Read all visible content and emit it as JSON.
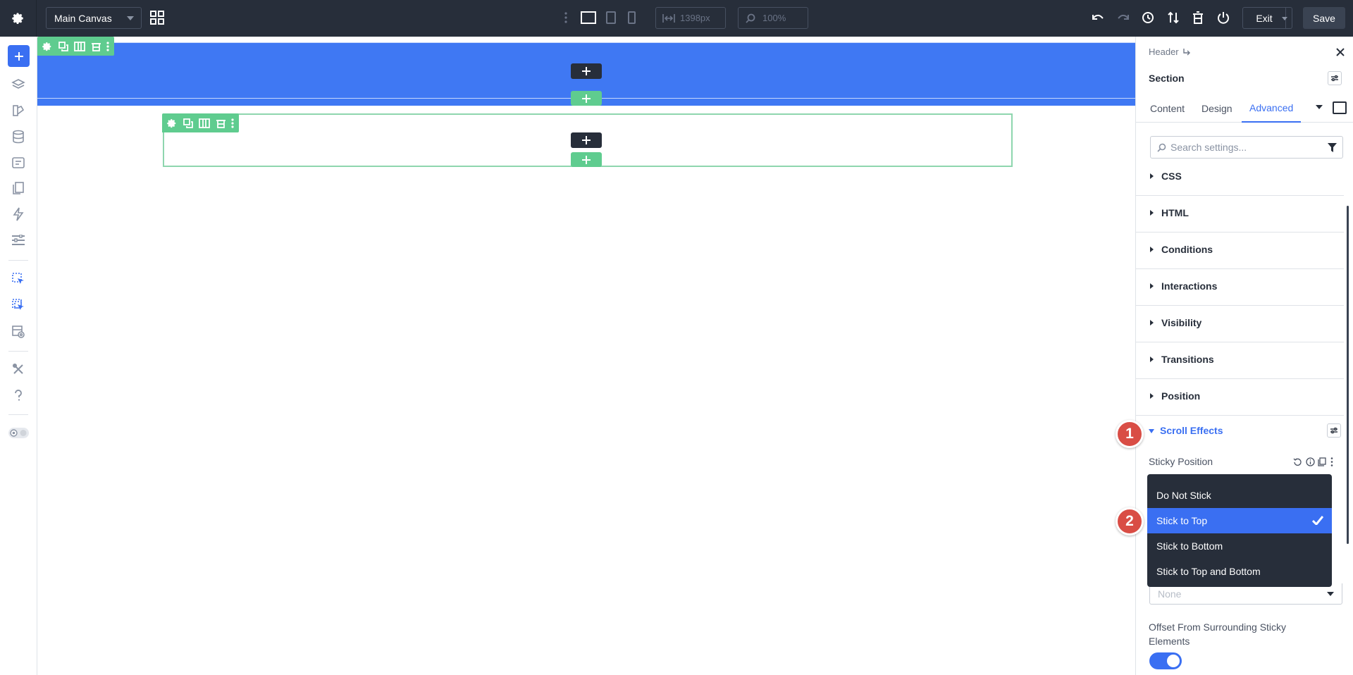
{
  "topbar": {
    "canvas_select": "Main Canvas",
    "width_value": "1398px",
    "zoom_value": "100%",
    "exit_label": "Exit",
    "save_label": "Save"
  },
  "canvas": {
    "plus_symbol": "+"
  },
  "panel": {
    "breadcrumb": "Header",
    "title": "Section",
    "tabs": [
      {
        "label": "Content"
      },
      {
        "label": "Design"
      },
      {
        "label": "Advanced"
      }
    ],
    "search_placeholder": "Search settings...",
    "groups": [
      {
        "label": "CSS"
      },
      {
        "label": "HTML"
      },
      {
        "label": "Conditions"
      },
      {
        "label": "Interactions"
      },
      {
        "label": "Visibility"
      },
      {
        "label": "Transitions"
      },
      {
        "label": "Position"
      }
    ],
    "scroll_effects": {
      "label": "Scroll Effects",
      "sticky_label": "Sticky Position",
      "options": [
        {
          "label": "Do Not Stick"
        },
        {
          "label": "Stick to Top"
        },
        {
          "label": "Stick to Bottom"
        },
        {
          "label": "Stick to Top and Bottom"
        }
      ],
      "selected_option": "Stick to Top",
      "none_value": "None",
      "offset_label": "Offset From Surrounding Sticky Elements",
      "offset_enabled": true
    }
  },
  "annotations": {
    "step1": "1",
    "step2": "2"
  },
  "colors": {
    "accent": "#3a6ff2",
    "header_section": "#3f78f3",
    "module_green": "#5fcc8f",
    "dark": "#272e3a",
    "badge_red": "#d94d45"
  }
}
